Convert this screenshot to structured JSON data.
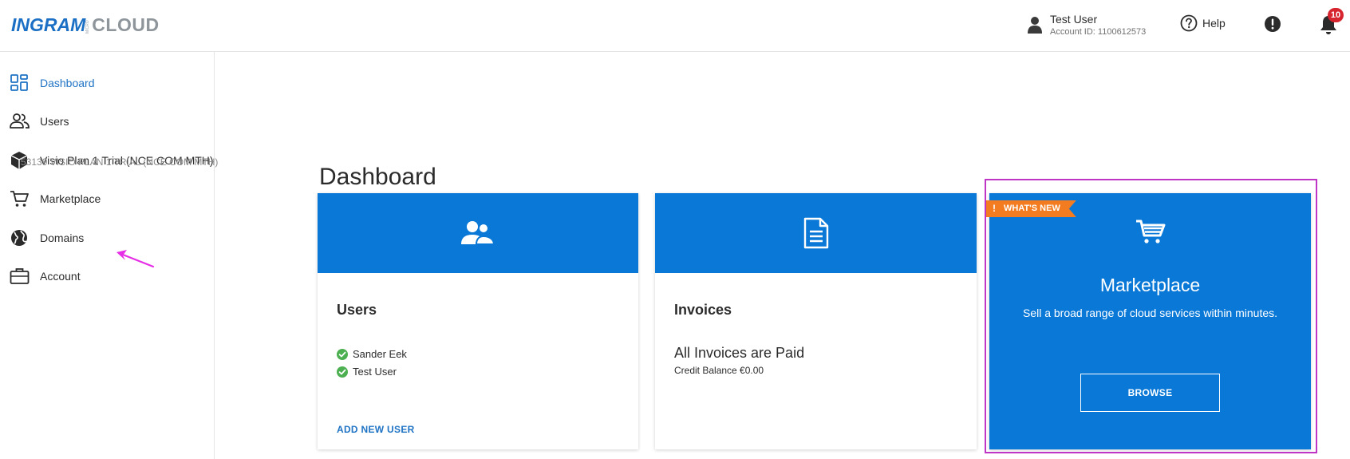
{
  "header": {
    "logo_text": "INGRAM",
    "logo_micro": "MICRO",
    "logo_cloud": "CLOUD",
    "user_name": "Test User",
    "account_id": "Account ID: 1100612573",
    "help_label": "Help",
    "notification_count": "10"
  },
  "sidebar": {
    "items": [
      {
        "label": "Dashboard",
        "icon": "dashboard-icon",
        "active": true
      },
      {
        "label": "Users",
        "icon": "users-icon"
      },
      {
        "label": "Visio Plan 1 Trial (NCE COM MTH)",
        "icon": "box-icon"
      },
      {
        "label": "Marketplace",
        "icon": "cart-icon"
      },
      {
        "label": "Domains",
        "icon": "globe-icon"
      },
      {
        "label": "Account",
        "icon": "briefcase-icon"
      }
    ],
    "ghost_text": "53139 VISIO PLAN 1 TRIAL (NCE COM MTH)"
  },
  "main": {
    "title": "Dashboard",
    "users_card": {
      "title": "Users",
      "users": [
        "Sander Eek",
        "Test User"
      ],
      "action": "ADD NEW USER"
    },
    "invoices_card": {
      "title": "Invoices",
      "status": "All Invoices are Paid",
      "balance": "Credit Balance €0.00"
    },
    "marketplace_card": {
      "badge": "WHAT'S NEW",
      "badge_icon": "!",
      "title": "Marketplace",
      "description": "Sell a broad range of cloud services within minutes.",
      "button": "BROWSE"
    }
  },
  "colors": {
    "brand_blue": "#0a78d7",
    "link_blue": "#1f73c4",
    "badge_orange": "#f37c20",
    "highlight_magenta": "#bf35c5",
    "notification_red": "#d6252f",
    "check_green": "#4caf50"
  }
}
